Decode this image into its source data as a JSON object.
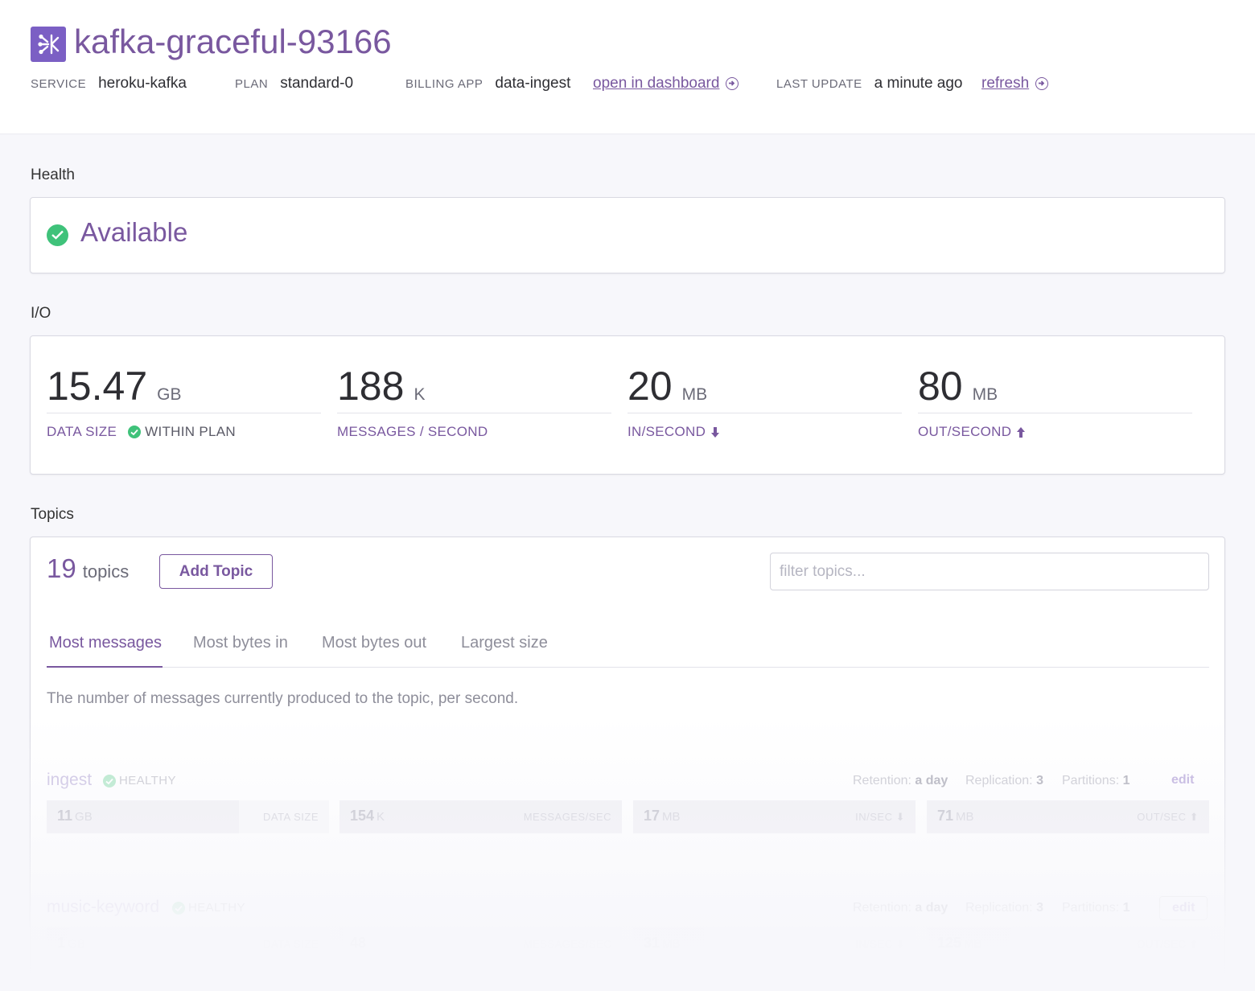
{
  "header": {
    "title": "kafka-graceful-93166",
    "logo_icon": "kafka-logo-icon",
    "service_label": "SERVICE",
    "service_value": "heroku-kafka",
    "plan_label": "PLAN",
    "plan_value": "standard-0",
    "billing_label": "BILLING APP",
    "billing_value": "data-ingest",
    "dashboard_link": "open in dashboard",
    "last_update_label": "LAST UPDATE",
    "last_update_value": "a minute ago",
    "refresh_link": "refresh"
  },
  "health": {
    "section_title": "Health",
    "status": "Available",
    "status_color": "#3fc27a"
  },
  "io": {
    "section_title": "I/O",
    "metrics": [
      {
        "value": "15.47",
        "unit": "GB",
        "label": "DATA SIZE",
        "badge": "WITHIN PLAN"
      },
      {
        "value": "188",
        "unit": "K",
        "label": "MESSAGES / SECOND"
      },
      {
        "value": "20",
        "unit": "MB",
        "label": "IN/SECOND"
      },
      {
        "value": "80",
        "unit": "MB",
        "label": "OUT/SECOND"
      }
    ]
  },
  "topics": {
    "section_title": "Topics",
    "count": "19",
    "count_label": "topics",
    "add_button": "Add Topic",
    "filter_placeholder": "filter topics...",
    "tabs": [
      "Most messages",
      "Most bytes in",
      "Most bytes out",
      "Largest size"
    ],
    "active_tab": 0,
    "description": "The number of messages currently produced to the topic, per second.",
    "list": [
      {
        "name": "ingest",
        "status": "HEALTHY",
        "retention_label": "Retention:",
        "retention": "a day",
        "replication_label": "Replication:",
        "replication": "3",
        "partitions_label": "Partitions:",
        "partitions": "1",
        "edit": "edit",
        "stats": [
          {
            "value": "11",
            "unit": "GB",
            "label": "DATA SIZE",
            "fill": 0.68
          },
          {
            "value": "154",
            "unit": "K",
            "label": "MESSAGES/SEC",
            "fill": 1.0
          },
          {
            "value": "17",
            "unit": "MB",
            "label": "IN/SEC ⬇",
            "fill": 1.0
          },
          {
            "value": "71",
            "unit": "MB",
            "label": "OUT/SEC ⬆",
            "fill": 1.0
          }
        ]
      },
      {
        "name": "music-keyword",
        "status": "HEALTHY",
        "retention_label": "Retention:",
        "retention": "a day",
        "replication_label": "Replication:",
        "replication": "3",
        "partitions_label": "Partitions:",
        "partitions": "1",
        "edit": "edit",
        "stats": [
          {
            "value": "1",
            "unit": "GB",
            "label": "DATA SIZE",
            "fill": 0.08
          },
          {
            "value": "48",
            "unit": "",
            "label": "MESSAGES/SEC",
            "fill": 0.01
          },
          {
            "value": "31",
            "unit": "MB",
            "label": "IN/SEC ⬇",
            "fill": 0.25
          },
          {
            "value": "125",
            "unit": "MB",
            "label": "OUT/SEC ⬆",
            "fill": 0.3
          }
        ]
      }
    ]
  }
}
